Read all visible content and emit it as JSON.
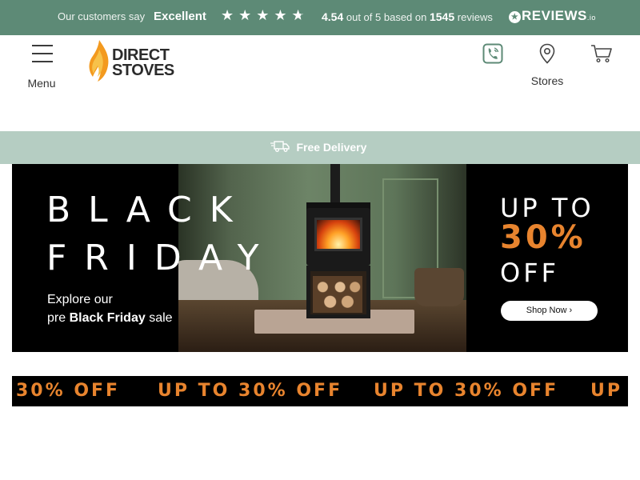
{
  "reviews_bar": {
    "customers_say": "Our customers say",
    "rating_word": "Excellent",
    "stars": "★★★★",
    "half_star": "★",
    "rating_value": "4.54",
    "out_of_text": "out of 5 based on",
    "review_count": "1545",
    "reviews_word": "reviews",
    "provider_name": "REVIEWS",
    "provider_suffix": ".io",
    "provider_mark": "★"
  },
  "header": {
    "menu_label": "Menu",
    "brand_line1": "DIRECT",
    "brand_line2": "STOVES",
    "stores_label": "Stores",
    "icons": [
      "phone-icon",
      "location-pin-icon",
      "cart-icon"
    ]
  },
  "delivery": {
    "text": "Free Delivery",
    "icon": "delivery-truck-icon"
  },
  "hero": {
    "title_line1": "BLACK",
    "title_line2": "FRIDAY",
    "explore_line1": "Explore our",
    "explore_pre": "pre",
    "explore_bold": "Black Friday",
    "explore_after": "sale",
    "up_to": "UP TO",
    "percent": "30%",
    "off": "OFF",
    "shop_now": "Shop Now ›"
  },
  "ticker": {
    "items": [
      "30% OFF",
      "UP TO 30% OFF",
      "UP TO 30% OFF",
      "UP T"
    ]
  },
  "colors": {
    "reviews_bg": "#5d8a76",
    "delivery_bg": "#b5cdc2",
    "accent_orange": "#e8842e",
    "flame_orange": "#f39a1f"
  }
}
